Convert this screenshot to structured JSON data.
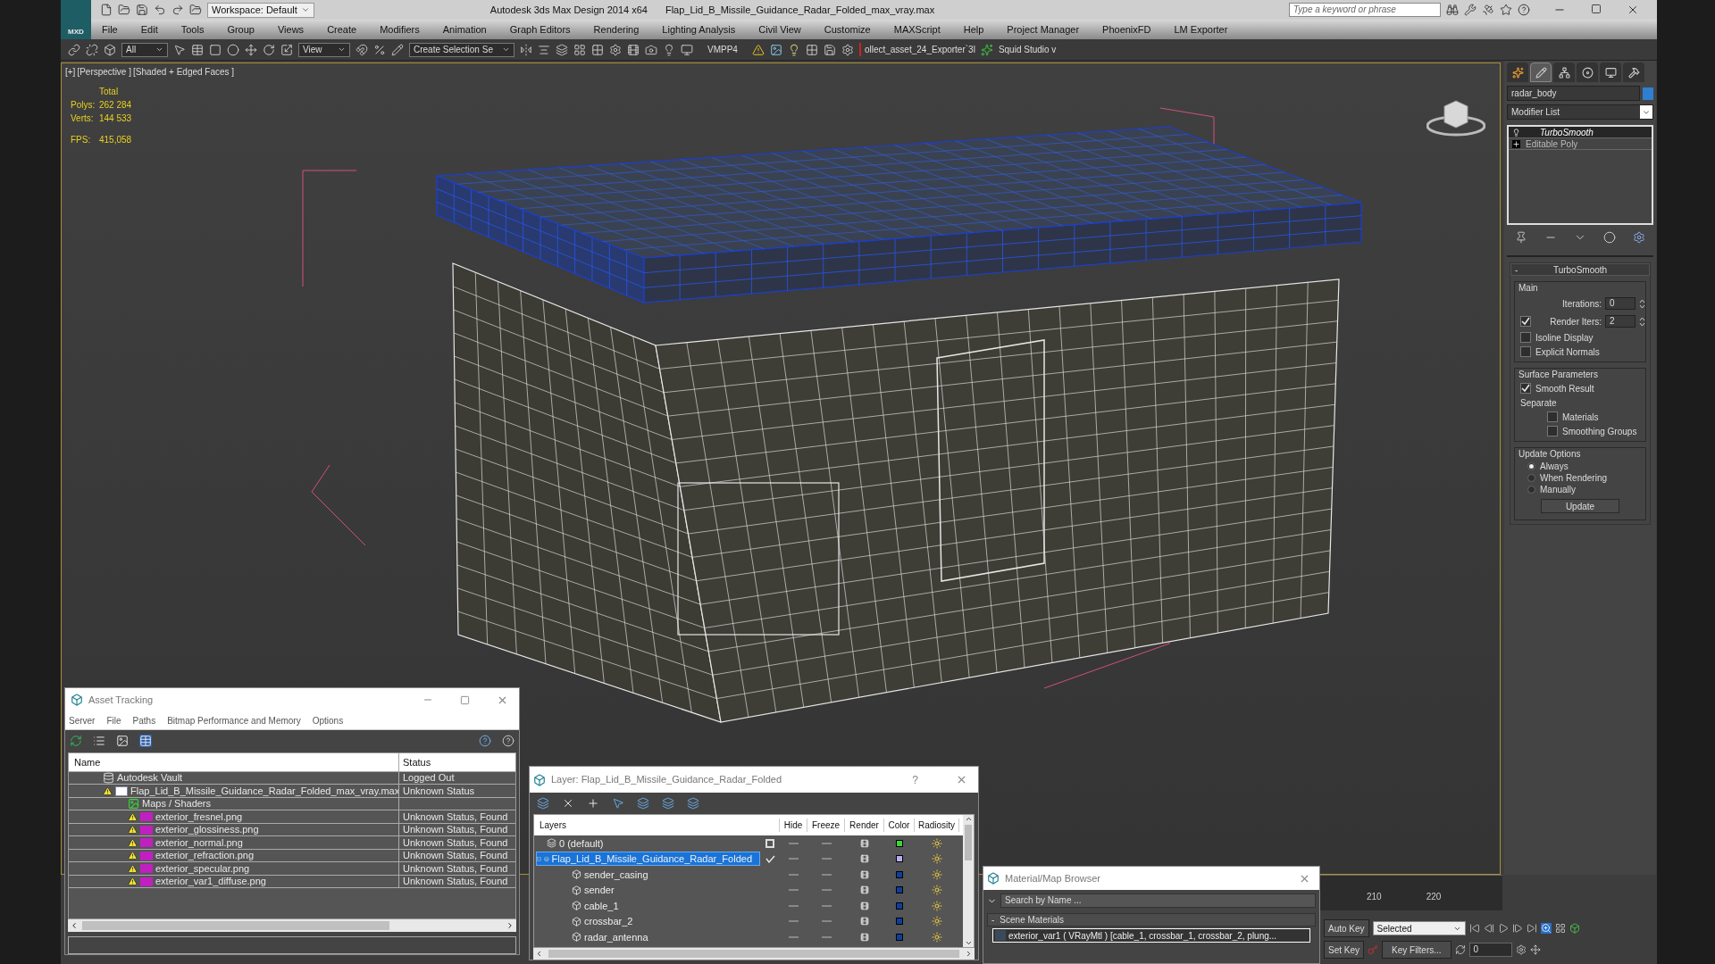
{
  "title_bar": {
    "logo_text": "MXD",
    "workspace": "Workspace: Default",
    "app_title": "Autodesk 3ds Max Design 2014 x64",
    "file_title": "Flap_Lid_B_Missile_Guidance_Radar_Folded_max_vray.max",
    "search": {
      "placeholder": "Type a keyword or phrase"
    }
  },
  "menu": [
    "File",
    "Edit",
    "Tools",
    "Group",
    "Views",
    "Create",
    "Modifiers",
    "Animation",
    "Graph Editors",
    "Rendering",
    "Lighting Analysis",
    "Civil View",
    "Customize",
    "MAXScript",
    "Help",
    "Project Manager",
    "PhoenixFD",
    "LM Exporter"
  ],
  "toolbar": {
    "selection_filter": "All",
    "coordinate_system": "View",
    "selection_set": "Create Selection Se",
    "script_label": "VMPP4",
    "exporter_label": "ollect_asset_24_Exporter`3l",
    "studio_label": "Squid Studio v"
  },
  "viewport": {
    "labels": [
      "[+]",
      "[Perspective ]",
      "[Shaded + Edged Faces ]"
    ],
    "stats": {
      "header": "Total",
      "rows": [
        {
          "label": "Polys:",
          "value": "262 284"
        },
        {
          "label": "Verts:",
          "value": "144 533"
        }
      ],
      "fps_label": "FPS:",
      "fps": "415,058"
    }
  },
  "command_panel": {
    "tabs": [
      {
        "selected": false
      },
      {
        "selected": true
      },
      {
        "selected": false
      },
      {
        "selected": false
      },
      {
        "selected": false
      },
      {
        "selected": false
      }
    ],
    "object_name": "radar_body",
    "modifier_list": "Modifier List",
    "stack": [
      {
        "name": "TurboSmooth",
        "kind": "modifier",
        "selected": true
      },
      {
        "name": "Editable Poly",
        "kind": "base",
        "selected": false
      }
    ],
    "rollout": {
      "collapse": "-",
      "title": "TurboSmooth",
      "groups": [
        {
          "title": "Main",
          "items": [
            {
              "kind": "spinner",
              "label": "Iterations:",
              "value": "0"
            },
            {
              "kind": "spinner",
              "label": "Render Iters:",
              "value": "2",
              "checked": true
            },
            {
              "kind": "checkbox",
              "label": "Isoline Display",
              "checked": false
            },
            {
              "kind": "checkbox",
              "label": "Explicit Normals",
              "checked": false
            }
          ]
        },
        {
          "title": "Surface Parameters",
          "items": [
            {
              "kind": "checkbox",
              "label": "Smooth Result",
              "checked": true
            },
            {
              "kind": "label",
              "label": "Separate",
              "children": [
                {
                  "kind": "checkbox",
                  "label": "Materials",
                  "checked": false
                },
                {
                  "kind": "checkbox",
                  "label": "Smoothing Groups",
                  "checked": false
                }
              ]
            }
          ]
        },
        {
          "title": "Update Options",
          "items": [
            {
              "kind": "radio",
              "label": "Always",
              "selected": true
            },
            {
              "kind": "radio",
              "label": "When Rendering",
              "selected": false
            },
            {
              "kind": "radio",
              "label": "Manually",
              "selected": false
            },
            {
              "kind": "button",
              "label": "Update"
            }
          ]
        }
      ]
    }
  },
  "asset_tracking": {
    "title": "Asset Tracking",
    "menu": [
      "Server",
      "File",
      "Paths",
      "Bitmap Performance and Memory",
      "Options"
    ],
    "columns": [
      "Name",
      "Status"
    ],
    "rows": [
      {
        "kind": "vault",
        "name": "Autodesk Vault",
        "status": "Logged Out",
        "warning": false,
        "children": [
          {
            "kind": "max",
            "name": "Flap_Lid_B_Missile_Guidance_Radar_Folded_max_vray.max",
            "status": "Unknown Status",
            "warning": true,
            "children": [
              {
                "kind": "maps",
                "name": "Maps / Shaders",
                "warning": false,
                "children": [
                  {
                    "kind": "png",
                    "name": "exterior_fresnel.png",
                    "status": "Unknown Status, Found",
                    "warning": true
                  },
                  {
                    "kind": "png",
                    "name": "exterior_glossiness.png",
                    "status": "Unknown Status, Found",
                    "warning": true
                  },
                  {
                    "kind": "png",
                    "name": "exterior_normal.png",
                    "status": "Unknown Status, Found",
                    "warning": true
                  },
                  {
                    "kind": "png",
                    "name": "exterior_refraction.png",
                    "status": "Unknown Status, Found",
                    "warning": true
                  },
                  {
                    "kind": "png",
                    "name": "exterior_specular.png",
                    "status": "Unknown Status, Found",
                    "warning": true
                  },
                  {
                    "kind": "png",
                    "name": "exterior_var1_diffuse.png",
                    "status": "Unknown Status, Found",
                    "warning": true
                  }
                ]
              }
            ]
          }
        ]
      }
    ]
  },
  "layer_dialog": {
    "title": "Layer: Flap_Lid_B_Missile_Guidance_Radar_Folded",
    "help": "?",
    "columns": [
      "Layers",
      "Hide",
      "Freeze",
      "Render",
      "Color",
      "Radiosity"
    ],
    "layers": [
      {
        "name": "0 (default)",
        "current": false,
        "selected": false,
        "color": "#3ad43a"
      },
      {
        "name": "Flap_Lid_B_Missile_Guidance_Radar_Folded",
        "current": true,
        "selected": true,
        "expanded": true,
        "color": "#b4aef0",
        "children": [
          {
            "name": "sender_casing",
            "selected": false,
            "color": "#0b3f9c"
          },
          {
            "name": "sender",
            "selected": false,
            "color": "#0b3f9c"
          },
          {
            "name": "cable_1",
            "selected": false,
            "color": "#0b3f9c"
          },
          {
            "name": "crossbar_2",
            "selected": false,
            "color": "#0b3f9c"
          },
          {
            "name": "radar_antenna",
            "selected": false,
            "color": "#0b3f9c"
          }
        ]
      }
    ]
  },
  "material_browser": {
    "title": "Material/Map Browser",
    "search": {
      "placeholder": "Search by Name ..."
    },
    "section": {
      "collapse": "-",
      "title": "Scene Materials"
    },
    "items": [
      "exterior_var1  ( VRayMtl ) [cable_1, crossbar_1, crossbar_2, plung..."
    ]
  },
  "time_controls": {
    "ticks": [
      "210",
      "220"
    ],
    "auto_key": "Auto Key",
    "key_mode": "Selected",
    "set_key": "Set Key",
    "key_filters": "Key Filters...",
    "frame": "0"
  }
}
